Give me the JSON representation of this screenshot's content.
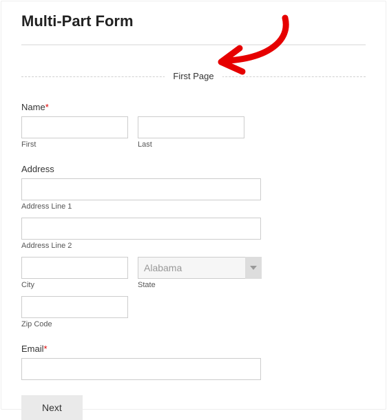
{
  "header": {
    "title": "Multi-Part Form"
  },
  "page_divider": {
    "label": "First Page"
  },
  "name": {
    "label": "Name",
    "required_mark": "*",
    "first_sub": "First",
    "last_sub": "Last",
    "first_value": "",
    "last_value": ""
  },
  "address": {
    "label": "Address",
    "line1_value": "",
    "line1_sub": "Address Line 1",
    "line2_value": "",
    "line2_sub": "Address Line 2",
    "city_value": "",
    "city_sub": "City",
    "state_value": "Alabama",
    "state_sub": "State",
    "zip_value": "",
    "zip_sub": "Zip Code"
  },
  "email": {
    "label": "Email",
    "required_mark": "*",
    "value": ""
  },
  "buttons": {
    "next": "Next"
  },
  "annotation": {
    "arrow_color": "#e60000"
  }
}
